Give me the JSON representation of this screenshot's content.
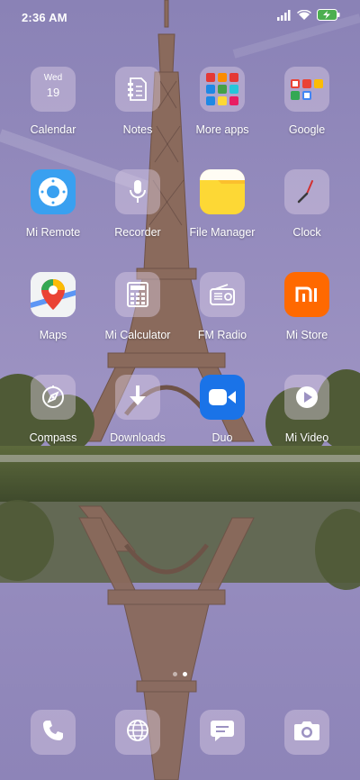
{
  "status_bar": {
    "time": "2:36 AM",
    "icons": [
      "signal-icon",
      "wifi-icon",
      "battery-charging-icon"
    ]
  },
  "apps": [
    {
      "label": "Calendar",
      "icon": "calendar-icon",
      "day": "Wed",
      "date": "19"
    },
    {
      "label": "Notes",
      "icon": "notes-icon"
    },
    {
      "label": "More apps",
      "icon": "folder-icon"
    },
    {
      "label": "Google",
      "icon": "folder-icon"
    },
    {
      "label": "Mi Remote",
      "icon": "remote-icon",
      "color": "#39a0f0"
    },
    {
      "label": "Recorder",
      "icon": "microphone-icon"
    },
    {
      "label": "File Manager",
      "icon": "folder-icon",
      "color": "#fbc02d"
    },
    {
      "label": "Clock",
      "icon": "clock-icon"
    },
    {
      "label": "Maps",
      "icon": "map-pin-icon"
    },
    {
      "label": "Mi Calculator",
      "icon": "calculator-icon"
    },
    {
      "label": "FM Radio",
      "icon": "radio-icon"
    },
    {
      "label": "Mi Store",
      "icon": "mi-logo-icon",
      "color": "#ff6900"
    },
    {
      "label": "Compass",
      "icon": "compass-icon"
    },
    {
      "label": "Downloads",
      "icon": "download-icon"
    },
    {
      "label": "Duo",
      "icon": "video-camera-icon",
      "color": "#1a73e8"
    },
    {
      "label": "Mi Video",
      "icon": "play-icon"
    }
  ],
  "dock": [
    {
      "name": "phone",
      "icon": "phone-icon"
    },
    {
      "name": "browser",
      "icon": "globe-icon"
    },
    {
      "name": "messages",
      "icon": "message-icon"
    },
    {
      "name": "camera",
      "icon": "camera-icon"
    }
  ],
  "page_indicator": {
    "pages": 2,
    "current": 2
  }
}
